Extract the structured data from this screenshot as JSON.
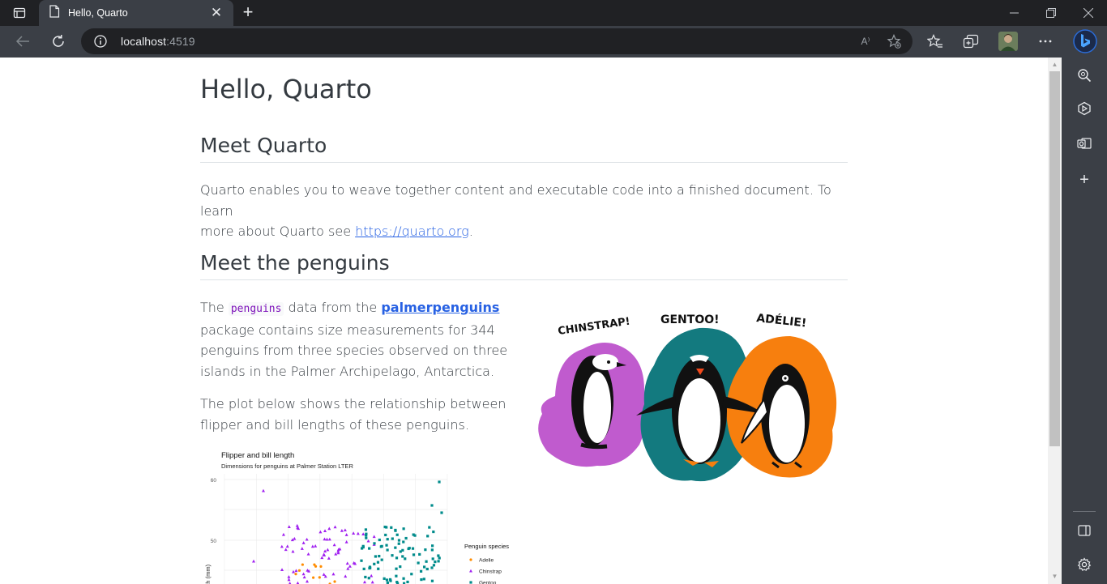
{
  "browser": {
    "tab_title": "Hello, Quarto",
    "url_host": "localhost",
    "url_port": ":4519",
    "read_aloud_label": "A⁾",
    "colors": {
      "titlebar": "#202124",
      "toolbar": "#3b3f46",
      "link": "#2761e3",
      "code": "#7d12ba"
    }
  },
  "page": {
    "title": "Hello, Quarto",
    "section1": {
      "heading": "Meet Quarto",
      "line1": "Quarto enables you to weave together content and executable code into a finished document. To learn",
      "line2_prefix": "more about Quarto see ",
      "link": "https://quarto.org",
      "line2_suffix": "."
    },
    "section2": {
      "heading": "Meet the penguins",
      "p1_the": "The ",
      "p1_code": "penguins",
      "p1_mid": " data from the ",
      "p1_link": "palmerpenguins",
      "p1_line2": "package contains size measurements for 344",
      "p1_line3": "penguins from three species observed on three",
      "p1_line4": "islands in the Palmer Archipelago, Antarctica.",
      "p2_line1": "The plot below shows the relationship between",
      "p2_line2": "flipper and bill lengths of these penguins."
    },
    "artwork_labels": {
      "chinstrap": "CHINSTRAP!",
      "gentoo": "GENTOO!",
      "adelie": "ADÉLIE!"
    },
    "plot": {
      "title": "Flipper and bill length",
      "subtitle": "Dimensions for penguins at Palmer Station LTER",
      "ylabel": "Bill length (mm)",
      "ytick_top": "60",
      "ytick_mid": "50",
      "legend_title": "Penguin species",
      "legend_items": [
        "Adelie",
        "Chinstrap",
        "Gentoo"
      ],
      "legend_colors": [
        "#ff8c00",
        "#a020f0",
        "#008b8b"
      ]
    }
  }
}
